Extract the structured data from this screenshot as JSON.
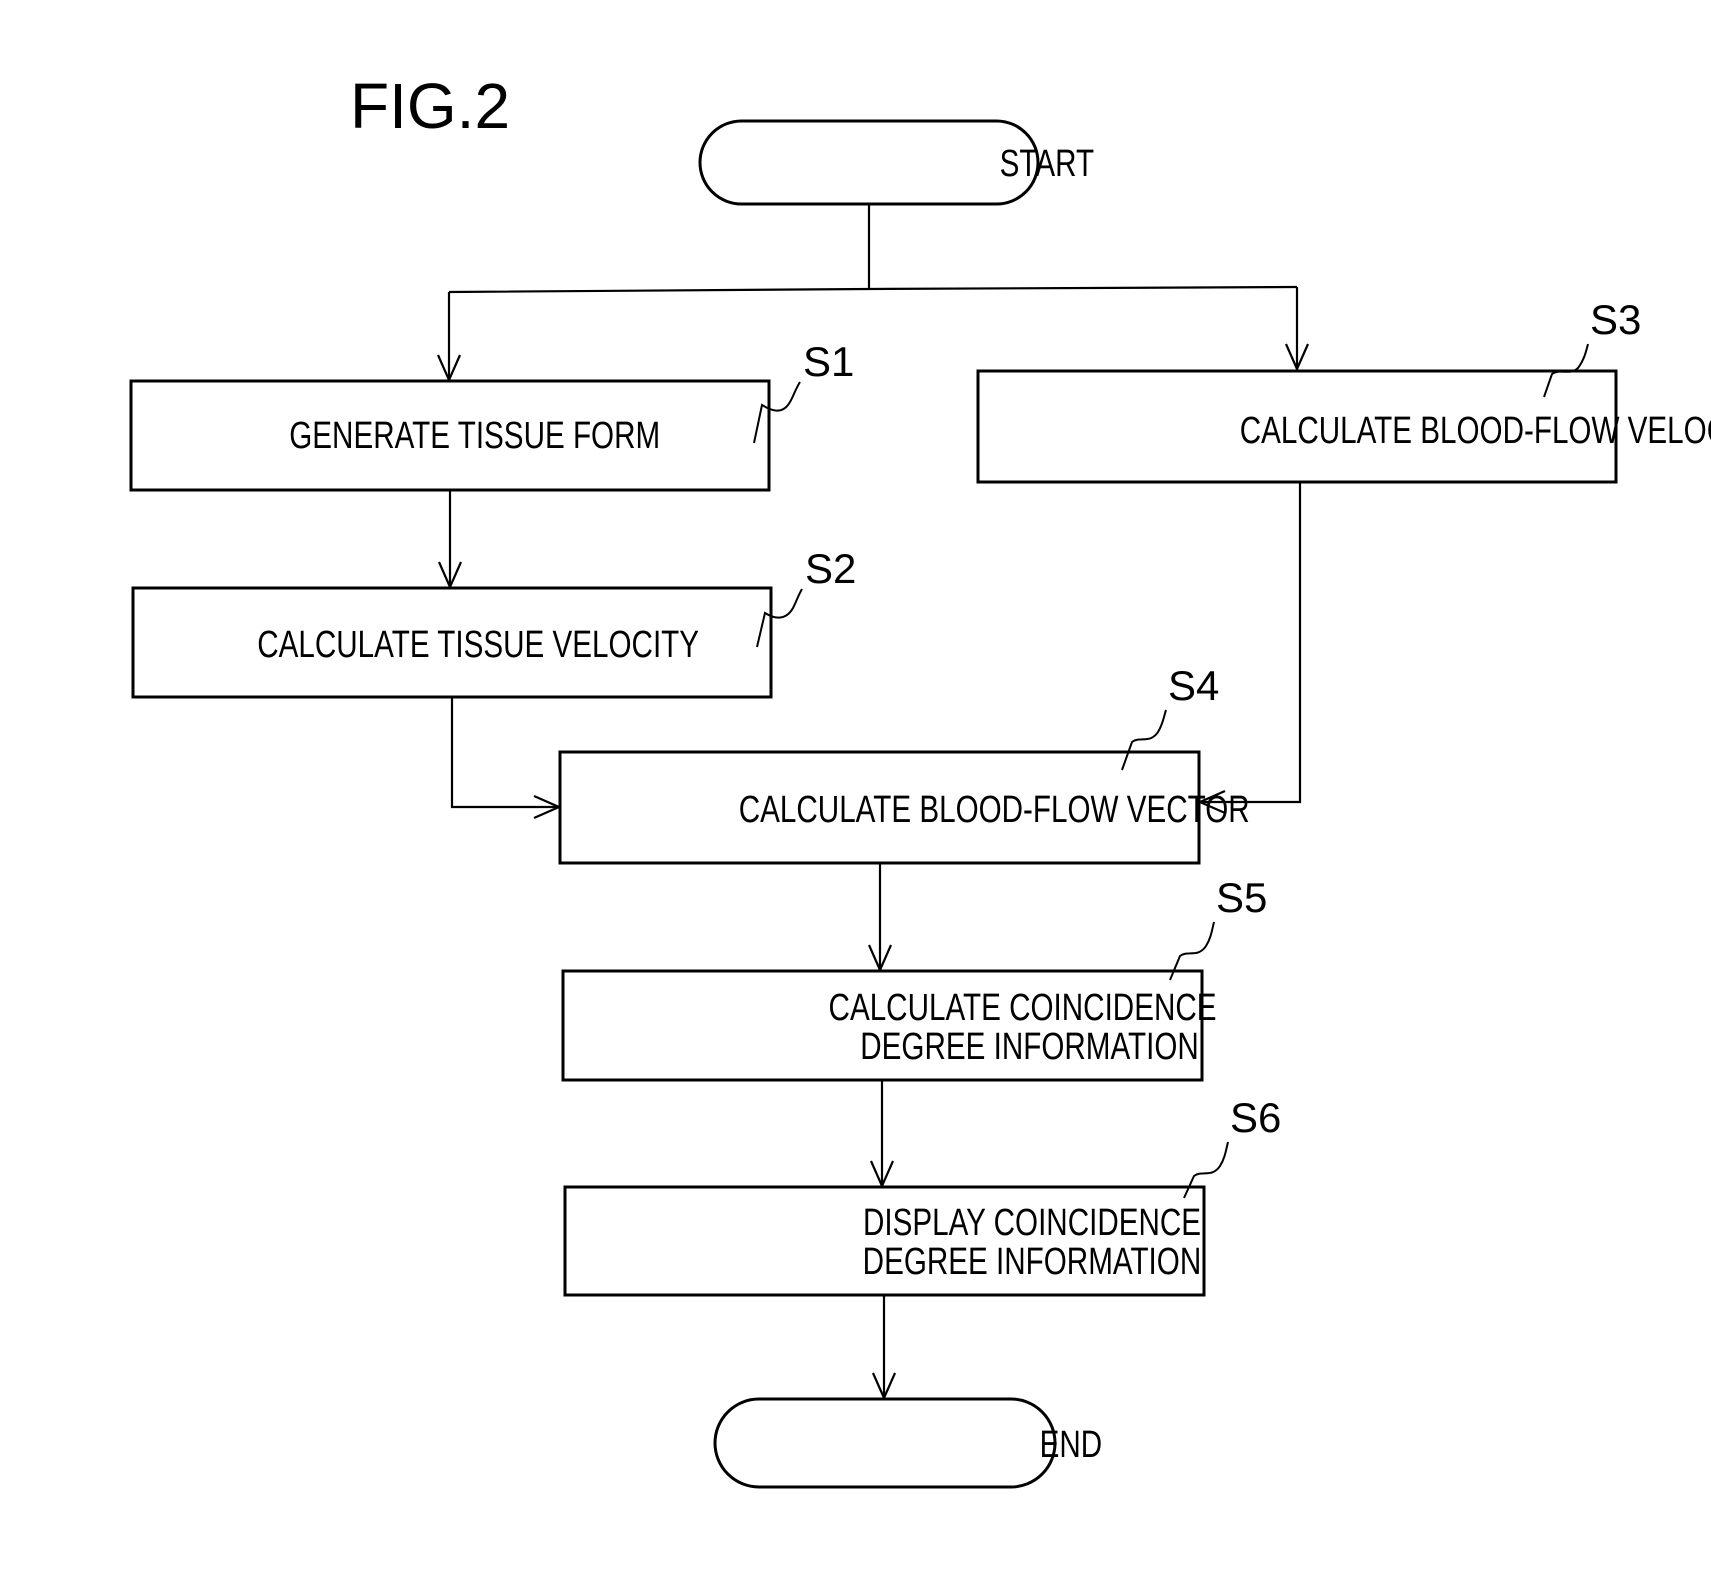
{
  "figure": {
    "title": "FIG.2"
  },
  "nodes": {
    "start": {
      "type": "terminal",
      "label": "START"
    },
    "s1": {
      "type": "process",
      "step": "S1",
      "lines": [
        "GENERATE TISSUE FORM"
      ]
    },
    "s2": {
      "type": "process",
      "step": "S2",
      "lines": [
        "CALCULATE TISSUE VELOCITY"
      ]
    },
    "s3": {
      "type": "process",
      "step": "S3",
      "lines": [
        "CALCULATE BLOOD-FLOW VELOCITY"
      ]
    },
    "s4": {
      "type": "process",
      "step": "S4",
      "lines": [
        "CALCULATE BLOOD-FLOW VECTOR"
      ]
    },
    "s5": {
      "type": "process",
      "step": "S5",
      "lines": [
        "CALCULATE COINCIDENCE",
        "DEGREE INFORMATION"
      ]
    },
    "s6": {
      "type": "process",
      "step": "S6",
      "lines": [
        "DISPLAY COINCIDENCE",
        "DEGREE INFORMATION"
      ]
    },
    "end": {
      "type": "terminal",
      "label": "END"
    }
  },
  "edges": [
    {
      "from": "start",
      "to": "s1"
    },
    {
      "from": "start",
      "to": "s3"
    },
    {
      "from": "s1",
      "to": "s2"
    },
    {
      "from": "s2",
      "to": "s4"
    },
    {
      "from": "s3",
      "to": "s4"
    },
    {
      "from": "s4",
      "to": "s5"
    },
    {
      "from": "s5",
      "to": "s6"
    },
    {
      "from": "s6",
      "to": "end"
    }
  ]
}
